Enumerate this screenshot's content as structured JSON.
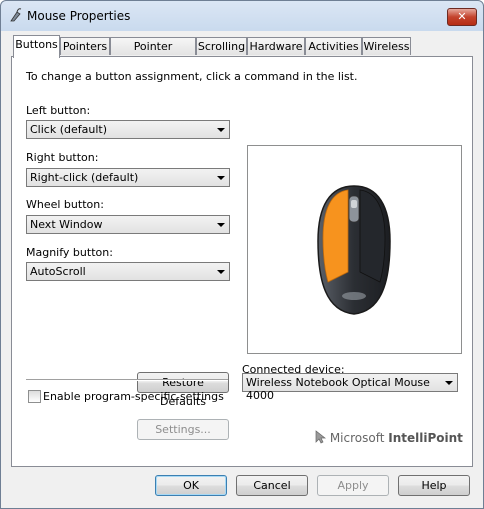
{
  "window": {
    "title": "Mouse Properties",
    "close_glyph": "✕"
  },
  "tabs": [
    "Buttons",
    "Pointers",
    "Pointer Options",
    "Scrolling",
    "Hardware",
    "Activities",
    "Wireless"
  ],
  "instructions": "To change a button assignment, click a command in the list.",
  "left_button": {
    "label": "Left button:",
    "value": "Click (default)"
  },
  "right_button": {
    "label": "Right button:",
    "value": "Right-click (default)"
  },
  "wheel_button": {
    "label": "Wheel button:",
    "value": "Next Window"
  },
  "magnify_button": {
    "label": "Magnify button:",
    "value": "AutoScroll"
  },
  "restore_defaults": "Restore Defaults",
  "connected_device": {
    "label": "Connected device:",
    "value": "Wireless Notebook Optical Mouse 4000"
  },
  "program_specific": {
    "label": "Enable program-specific settings",
    "checked": false
  },
  "settings_button": "Settings...",
  "brand": {
    "prefix": "Microsoft ",
    "name": "IntelliPoint"
  },
  "footer": {
    "ok": "OK",
    "cancel": "Cancel",
    "apply": "Apply",
    "help": "Help"
  },
  "colors": {
    "mouse_accent": "#f7931e",
    "mouse_body": "#2e3136"
  }
}
